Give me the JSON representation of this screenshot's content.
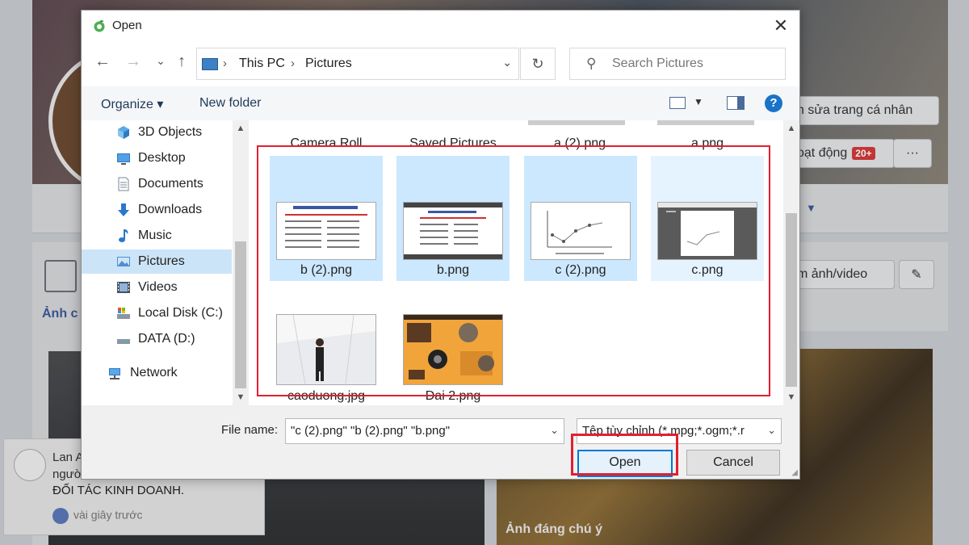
{
  "background": {
    "buttons": {
      "edit_profile": "h sửa trang cá nhân",
      "activity": "oạt động",
      "activity_badge": "20+",
      "more": "···",
      "add_photo": "m ảnh/video",
      "section_label": "Ảnh c"
    },
    "notification": {
      "name": "Lan A",
      "line2": "ngườ",
      "line3": "ĐỐI TÁC KINH DOANH.",
      "time": "vài giây trước"
    },
    "photo_caption": "Ảnh đáng chú ý"
  },
  "dialog": {
    "title": "Open",
    "close": "✕",
    "nav": {
      "back": "←",
      "forward": "→",
      "recent": "⌄",
      "up": "↑"
    },
    "breadcrumb": [
      "This PC",
      "Pictures"
    ],
    "search_placeholder": "Search Pictures",
    "toolbar": {
      "organize": "Organize ▾",
      "new_folder": "New folder",
      "help": "?"
    },
    "nav_pane": [
      {
        "label": "3D Objects",
        "icon": "cube-icon",
        "color": "#3b8ed8"
      },
      {
        "label": "Desktop",
        "icon": "desktop-icon",
        "color": "#2f7ac4"
      },
      {
        "label": "Documents",
        "icon": "document-icon",
        "color": "#8a9bb0"
      },
      {
        "label": "Downloads",
        "icon": "download-icon",
        "color": "#2a78c9"
      },
      {
        "label": "Music",
        "icon": "music-icon",
        "color": "#2a78c9"
      },
      {
        "label": "Pictures",
        "icon": "pictures-icon",
        "color": "#4e8fd1",
        "selected": true
      },
      {
        "label": "Videos",
        "icon": "video-icon",
        "color": "#4a5260"
      },
      {
        "label": "Local Disk (C:)",
        "icon": "disk-icon",
        "color": "#6d7a8a"
      },
      {
        "label": "DATA (D:)",
        "icon": "drive-icon",
        "color": "#6d7a8a"
      }
    ],
    "network_label": "Network",
    "top_row": [
      "Camera Roll",
      "Saved Pictures",
      "a (2).png",
      "a.png"
    ],
    "files_row1": [
      {
        "name": "b (2).png",
        "state": "selected"
      },
      {
        "name": "b.png",
        "state": "selected"
      },
      {
        "name": "c (2).png",
        "state": "selected"
      },
      {
        "name": "c.png",
        "state": "hover"
      }
    ],
    "files_row2": [
      {
        "name": "caoduong.jpg"
      },
      {
        "name": "Dai 2.png"
      }
    ],
    "file_name_label": "File name:",
    "file_name_value": "\"c (2).png\" \"b (2).png\" \"b.png\"",
    "file_type_value": "Tệp tùy chỉnh (*.mpg;*.ogm;*.r",
    "open_label": "Open",
    "cancel_label": "Cancel"
  },
  "colors": {
    "selection": "#cce8ff",
    "highlight_red": "#e02030",
    "accent": "#0078d7"
  }
}
